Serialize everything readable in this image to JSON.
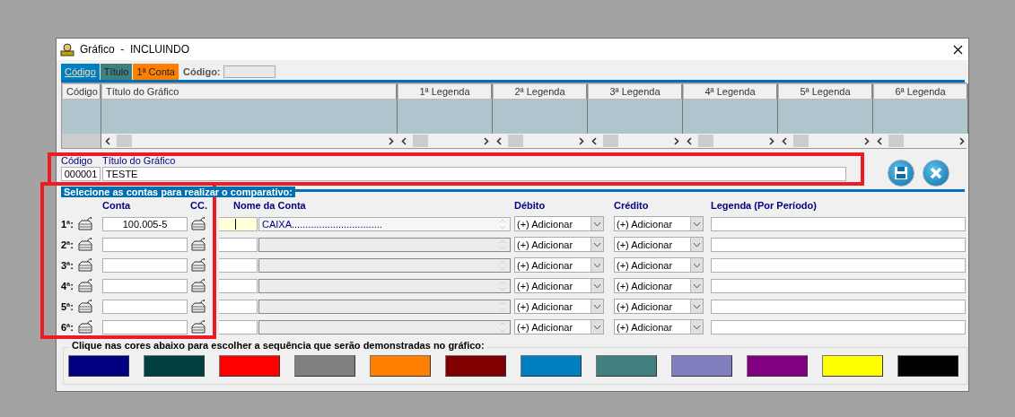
{
  "window": {
    "title": "Gráfico  -  INCLUINDO"
  },
  "tabs": [
    {
      "label": "Código",
      "selected": true,
      "color": "#0080c0"
    },
    {
      "label": "Título",
      "selected": false,
      "color": "#408080"
    },
    {
      "label": "1ª Conta",
      "selected": false,
      "color": "#ff8000"
    }
  ],
  "search": {
    "label": "Código:"
  },
  "grid": {
    "columns": [
      "Código",
      "Título do Gráfico",
      "1ª Legenda",
      "2ª Legenda",
      "3ª Legenda",
      "4ª Legenda",
      "5ª Legenda",
      "6ª Legenda"
    ]
  },
  "form": {
    "code_label": "Código",
    "code": "000001",
    "title_label": "Título do Gráfico",
    "title": "TESTE"
  },
  "section": {
    "title": "Selecione as contas para realizar o comparativo:",
    "columns": [
      "Conta",
      "CC.",
      "Nome da Conta",
      "Débito",
      "Crédito",
      "Legenda (Por Período)"
    ]
  },
  "rows": [
    {
      "label": "1ª:",
      "account": "100.005-5",
      "cc_focused": true,
      "name": "CAIXA.................................",
      "name_disabled": false,
      "debit": "(+) Adicionar",
      "credit": "(+) Adicionar"
    },
    {
      "label": "2ª:",
      "cc_focused": false,
      "name_disabled": true,
      "debit": "(+) Adicionar",
      "credit": "(+) Adicionar"
    },
    {
      "label": "3ª:",
      "cc_focused": false,
      "name_disabled": true,
      "debit": "(+) Adicionar",
      "credit": "(+) Adicionar"
    },
    {
      "label": "4ª:",
      "cc_focused": false,
      "name_disabled": true,
      "debit": "(+) Adicionar",
      "credit": "(+) Adicionar"
    },
    {
      "label": "5ª:",
      "cc_focused": false,
      "name_disabled": true,
      "debit": "(+) Adicionar",
      "credit": "(+) Adicionar"
    },
    {
      "label": "6ª:",
      "cc_focused": false,
      "name_disabled": true,
      "debit": "(+) Adicionar",
      "credit": "(+) Adicionar"
    }
  ],
  "colors_label": "Clique nas cores abaixo para escolher a sequência que serão demonstradas no gráfico:",
  "colors": [
    {
      "color": "#000080"
    },
    {
      "color": "#004040"
    },
    {
      "color": "#ff0000"
    },
    {
      "color": "#808080"
    },
    {
      "color": "#ff8000"
    },
    {
      "color": "#800000"
    },
    {
      "color": "#0080c0"
    },
    {
      "color": "#408080"
    },
    {
      "color": "#8080c0"
    },
    {
      "color": "#800080"
    },
    {
      "color": "#ffff00"
    },
    {
      "color": "#000000"
    }
  ]
}
